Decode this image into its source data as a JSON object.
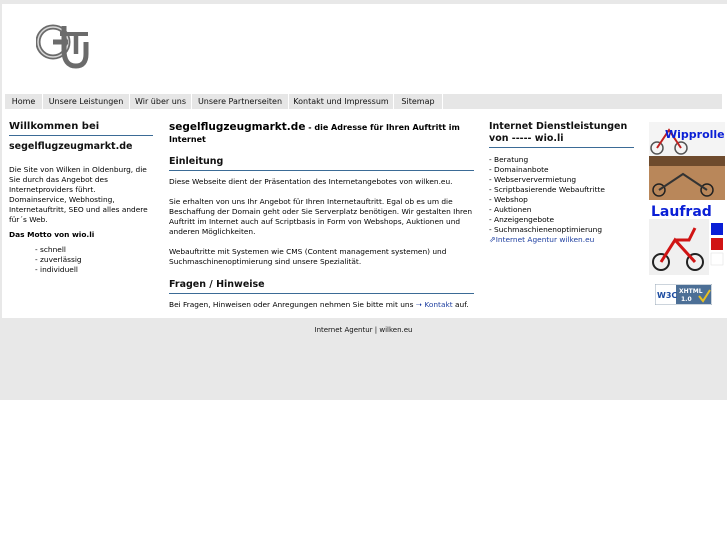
{
  "nav": [
    "Home",
    "Unsere Leistungen",
    "Wir über uns",
    "Unsere Partnerseiten",
    "Kontakt und Impressum",
    "Sitemap"
  ],
  "left": {
    "heading": "Willkommen bei",
    "subheading": "segelflugzeugmarkt.de",
    "intro_lines": [
      "Die Site von Wilken in Oldenburg, die",
      "Sie durch das Angebot des",
      "Internetproviders führt.",
      "Domainservice, Webhosting,",
      "Internetauftritt, SEO und alles andere",
      "für´s Web."
    ],
    "motto_title": "Das Motto von wio.li",
    "motto_items": [
      "- schnell",
      "- zuverlässig",
      "- individuell"
    ]
  },
  "main": {
    "title": "segelflugzeugmarkt.de",
    "title_suffix": " - die Adresse für Ihren Auftritt im",
    "title_line2": "Internet",
    "section1_heading": "Einleitung",
    "para1": "Diese Webseite dient der Präsentation des Internetangebotes von wilken.eu.",
    "para2_lines": [
      "Sie erhalten von uns Ihr Angebot für Ihren Internetauftritt. Egal ob es um die",
      "Beschaffung der Domain geht oder Sie Serverplatz benötigen. Wir gestalten Ihren",
      "Auftritt im Internet auch auf Scriptbasis in Form von Webshops, Auktionen und",
      "anderen Möglichkeiten."
    ],
    "para3_lines": [
      "Webauftritte mit Systemen wie CMS (Content management systemen) und",
      "Suchmaschinenoptimierung sind unsere Spezialität."
    ],
    "section2_heading": "Fragen / Hinweise",
    "contact_prefix": "Bei Fragen, Hinweisen oder Anregungen nehmen Sie bitte mit uns",
    "contact_link": "Kontakt",
    "contact_suffix": " auf."
  },
  "right": {
    "heading_line1": "Internet Dienstleistungen",
    "heading_line2": "von ----- wio.li",
    "items": [
      "- Beratung",
      "- Domainanbote",
      "- Webserververmietung",
      "- Scriptbasierende Webauftritte",
      "- Webshop",
      "- Auktionen",
      "- Anzeigengebote",
      "- Suchmaschienenoptimierung"
    ],
    "agency_link": "Internet Agentur wilken.eu"
  },
  "ad": {
    "line1": "Wipproller",
    "line2": "Laufrad"
  },
  "badge": {
    "left": "W3C",
    "right_top": "XHTML",
    "right_bottom": "1.0"
  },
  "footer": "Internet Agentur | wilken.eu",
  "colors": {
    "accent": "#3b6b96",
    "link": "#1e3fa0",
    "ad_blue": "#0a1fd6",
    "ad_red": "#d01414"
  }
}
